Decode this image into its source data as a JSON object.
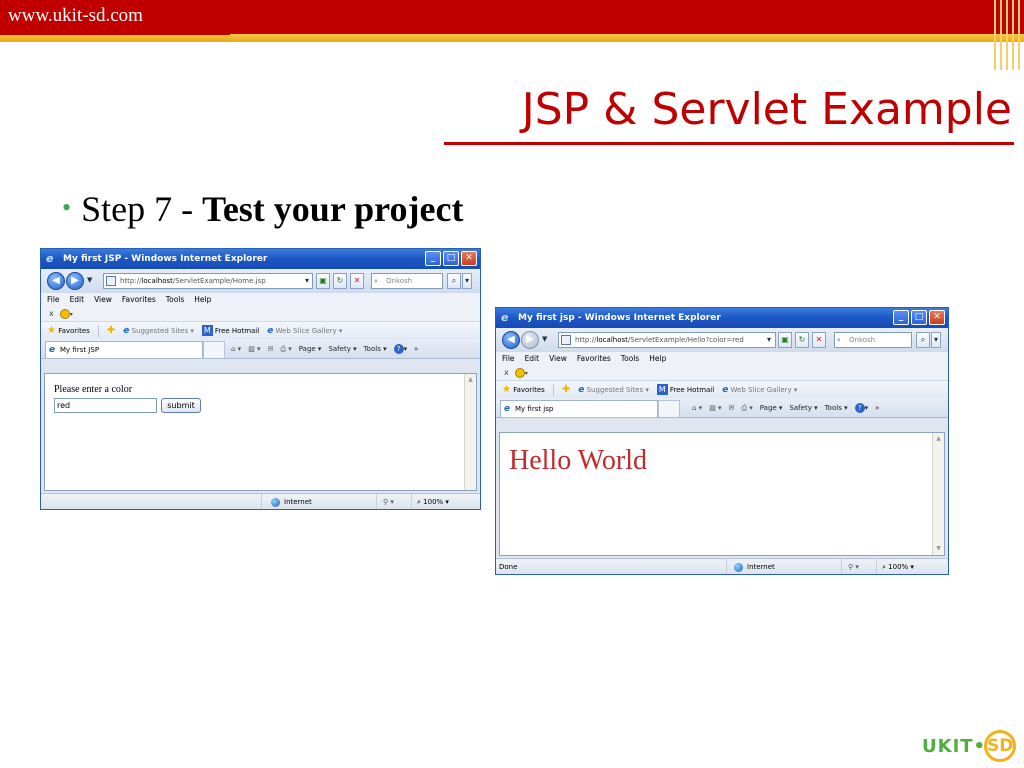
{
  "slide": {
    "site_url": "www.ukit-sd.com",
    "title": "JSP & Servlet Example",
    "bullet_step": "Step 7 - ",
    "bullet_bold": "Test your project",
    "logo_text": "UKIT•",
    "logo_badge": "SD",
    "colors": {
      "brand_red": "#c00000",
      "brand_gold": "#f2b21b",
      "bullet_green": "#3aa757"
    }
  },
  "window1": {
    "title": "My first JSP - Windows Internet Explorer",
    "address_prefix": "http://",
    "address_host": "localhost",
    "address_path": "/ServletExample/Home.jsp",
    "search_placeholder": "Onkosh",
    "menu": [
      "File",
      "Edit",
      "View",
      "Favorites",
      "Tools",
      "Help"
    ],
    "x_label": "x",
    "favorites_label": "Favorites",
    "suggested_sites": "Suggested Sites ▾",
    "free_hotmail": "Free Hotmail",
    "web_slice": "Web Slice Gallery ▾",
    "tab_title": "My first JSP",
    "cmd_page": "Page ▾",
    "cmd_safety": "Safety ▾",
    "cmd_tools": "Tools ▾",
    "status_zone": "Internet",
    "status_zoom": "100%",
    "page": {
      "label": "Please enter a color",
      "input_value": "red",
      "submit_label": "submit"
    }
  },
  "window2": {
    "title": "My first jsp - Windows Internet Explorer",
    "address_prefix": "http://",
    "address_host": "localhost",
    "address_path": "/ServletExample/Hello?color=red",
    "search_placeholder": "Onkosh",
    "menu": [
      "File",
      "Edit",
      "View",
      "Favorites",
      "Tools",
      "Help"
    ],
    "x_label": "x",
    "favorites_label": "Favorites",
    "suggested_sites": "Suggested Sites ▾",
    "free_hotmail": "Free Hotmail",
    "web_slice": "Web Slice Gallery ▾",
    "tab_title": "My first jsp",
    "cmd_page": "Page ▾",
    "cmd_safety": "Safety ▾",
    "cmd_tools": "Tools ▾",
    "status_text": "Done",
    "status_zone": "Internet",
    "status_zoom": "100%",
    "page": {
      "heading": "Hello World",
      "heading_color": "#c42a2a"
    }
  }
}
